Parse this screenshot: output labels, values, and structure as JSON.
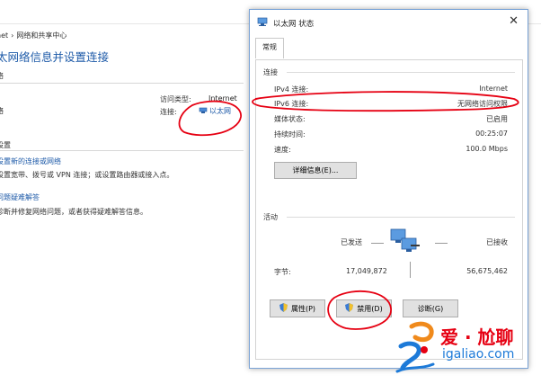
{
  "background": {
    "breadcrumb": [
      "net",
      "网络和共享中心"
    ],
    "title": "太网络信息并设置连接",
    "section_network": "络",
    "network_name": "络",
    "access_type_label": "访问类型:",
    "access_type_value": "Internet",
    "connection_label": "连接:",
    "connection_value": "以太网",
    "section_change": "设置",
    "link_new_connection": "设置新的连接或网络",
    "desc_new_connection": "设置宽带、拨号或 VPN 连接；或设置路由器或接入点。",
    "link_troubleshoot": "问题疑难解答",
    "desc_troubleshoot": "诊断并修复网络问题，或者获得疑难解答信息。"
  },
  "dialog": {
    "title": "以太网 状态",
    "close_glyph": "✕",
    "tab_general": "常规",
    "group_connection": "连接",
    "rows": [
      {
        "label": "IPv4 连接:",
        "value": "Internet"
      },
      {
        "label": "IPv6 连接:",
        "value": "无网络访问权限"
      },
      {
        "label": "媒体状态:",
        "value": "已启用"
      },
      {
        "label": "持续时间:",
        "value": "00:25:07"
      },
      {
        "label": "速度:",
        "value": "100.0 Mbps"
      }
    ],
    "details_button": "详细信息(E)...",
    "group_activity": "活动",
    "sent_label": "已发送",
    "received_label": "已接收",
    "bytes_label": "字节:",
    "bytes_sent": "17,049,872",
    "bytes_received": "56,675,462",
    "btn_properties": "属性(P)",
    "btn_disable": "禁用(D)",
    "btn_diagnose": "诊断(G)"
  },
  "watermark": {
    "cn": "爱 · 尬聊",
    "en": "igaliao.com"
  },
  "colors": {
    "link": "#1d5aa8",
    "annotation": "#e60012",
    "dialog_border": "#7aa3d6"
  }
}
